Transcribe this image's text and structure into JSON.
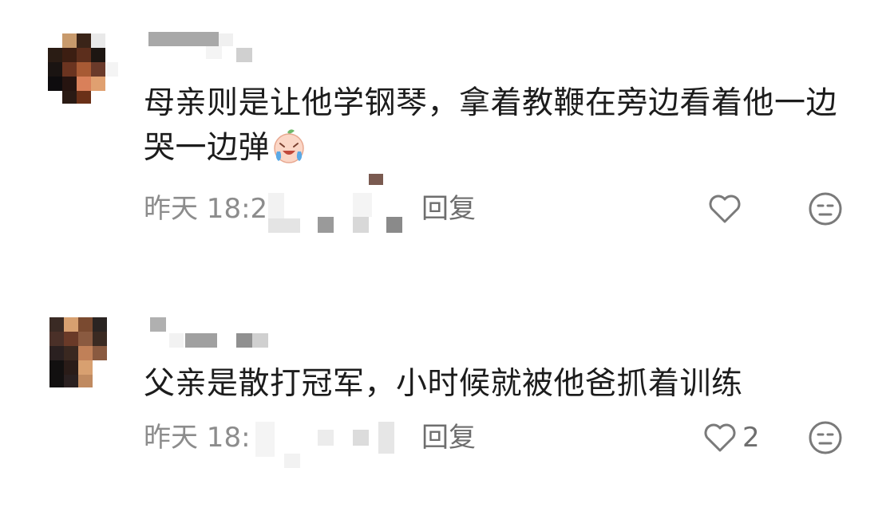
{
  "comments": [
    {
      "text": "母亲则是让他学钢琴，拿着教鞭在旁边看着他一边哭一边弹",
      "emoji": "crying-laugh-emoji",
      "time": "昨天 18:2",
      "reply_label": "回复",
      "like_count": ""
    },
    {
      "text": "父亲是散打冠军，小时候就被他爸抓着训练",
      "time": "昨天 18:",
      "reply_label": "回复",
      "like_count": "2"
    }
  ],
  "icons": {
    "like": "heart-outline-icon",
    "dislike": "meh-face-icon"
  },
  "colors": {
    "text": "#1c1c1c",
    "meta": "#8c8c8c",
    "icon": "#7a7a7a"
  }
}
